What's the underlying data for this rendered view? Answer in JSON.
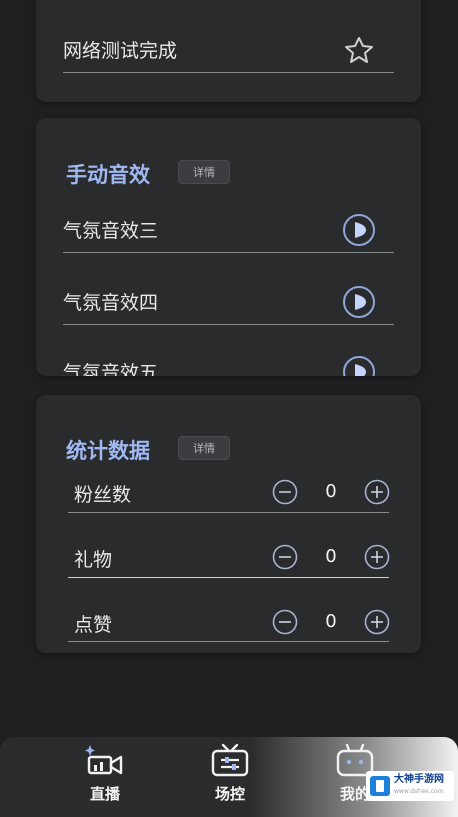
{
  "card_top": {
    "row_label": "网络测试完成",
    "star_icon": "star-icon"
  },
  "manual_effects": {
    "title": "手动音效",
    "detail_label": "详情",
    "items": [
      {
        "label": "气氛音效三",
        "icon": "play-icon"
      },
      {
        "label": "气氛音效四",
        "icon": "play-icon"
      },
      {
        "label": "气氛音效五",
        "icon": "play-icon"
      }
    ]
  },
  "stats": {
    "title": "统计数据",
    "detail_label": "详情",
    "rows": [
      {
        "label": "粉丝数",
        "value": "0"
      },
      {
        "label": "礼物",
        "value": "0"
      },
      {
        "label": "点赞",
        "value": "0"
      }
    ]
  },
  "nav": {
    "items": [
      {
        "label": "直播",
        "icon": "live-camera-icon"
      },
      {
        "label": "场控",
        "icon": "tv-control-icon"
      },
      {
        "label": "我的",
        "icon": "profile-robot-icon"
      }
    ]
  },
  "watermark": {
    "title": "大神手游网",
    "url": "www.dsfree.com"
  },
  "colors": {
    "background": "#1f2021",
    "card": "#2a2b2d",
    "accent_title": "#9fb8f2",
    "icon_ring": "#8fa6d8",
    "icon_fill": "#c5d4ff"
  }
}
